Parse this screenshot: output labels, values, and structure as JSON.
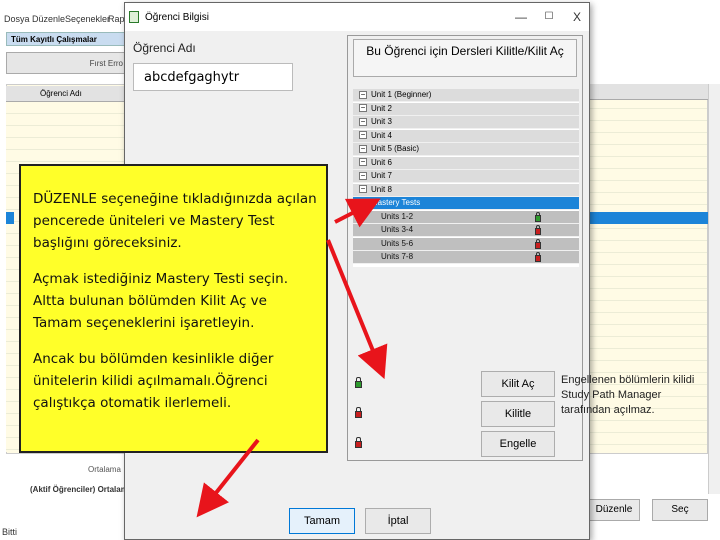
{
  "background": {
    "menu": [
      "Dosya",
      "Düzenle",
      "Seçenekler",
      "Rapor"
    ],
    "tab_label": "Tüm Kayıtlı Çalışmalar",
    "toolbar_label": "Fırst Erro",
    "list_header": "Öğrenci Adı",
    "footer_avg": "Ortalama",
    "footer_active": "(Aktif Öğrenciler) Ortalama",
    "status": "Bitti",
    "btn_duzenle": "Düzenle",
    "btn_sec": "Seç"
  },
  "dialog": {
    "title": "Öğrenci Bilgisi",
    "min": "—",
    "max": "☐",
    "close": "X",
    "name_label": "Öğrenci Adı",
    "name_value": "abcdefgaghytr",
    "panel_title": "Bu Öğrenci için Dersleri Kilitle/Kilit Aç",
    "tree": [
      {
        "label": "Unit 1 (Beginner)",
        "expander": "−"
      },
      {
        "label": "Unit 2",
        "expander": "−"
      },
      {
        "label": "Unit 3",
        "expander": "−"
      },
      {
        "label": "Unit 4",
        "expander": "−"
      },
      {
        "label": "Unit 5 (Basic)",
        "expander": "−"
      },
      {
        "label": "Unit 6",
        "expander": "−"
      },
      {
        "label": "Unit 7",
        "expander": "−"
      },
      {
        "label": "Unit 8",
        "expander": "−"
      },
      {
        "label": "Mastery Tests",
        "expander": "−"
      }
    ],
    "tree_children": [
      {
        "label": "Units 1-2",
        "lock_color": "#2e9b2e"
      },
      {
        "label": "Units 3-4",
        "lock_color": "#c81e1e"
      },
      {
        "label": "Units 5-6",
        "lock_color": "#c81e1e"
      },
      {
        "label": "Units 7-8",
        "lock_color": "#c81e1e"
      }
    ],
    "btn_kilit_ac": "Kilit Aç",
    "btn_kilitle": "Kilitle",
    "btn_engelle": "Engelle",
    "info": "Engellenen bölümlerin kilidi Study Path Manager tarafından açılmaz.",
    "btn_tamam": "Tamam",
    "btn_iptal": "İptal"
  },
  "note": {
    "p1": "DÜZENLE seçeneğine tıkladığınızda açılan pencerede üniteleri ve Mastery Test başlığını göreceksiniz.",
    "p2": "Açmak istediğiniz Mastery Testi seçin. Altta bulunan bölümden Kilit Aç ve Tamam seçeneklerini işaretleyin.",
    "p3": "Ancak bu bölümden kesinlikle diğer ünitelerin kilidi açılmamalı.Öğrenci çalıştıkça otomatik ilerlemeli."
  },
  "colors": {
    "note_bg": "#ffff29",
    "arrow": "#e8141b",
    "selection": "#1c84d8",
    "lock_green": "#2e9b2e",
    "lock_red": "#c81e1e"
  }
}
